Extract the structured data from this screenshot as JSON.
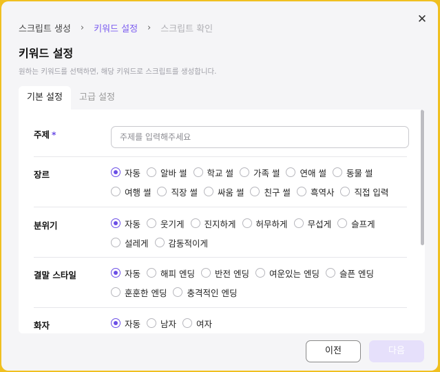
{
  "breadcrumb": {
    "step1": "스크립트 생성",
    "step2": "키워드 설정",
    "step3": "스크립트 확인",
    "separator": "›"
  },
  "dialog": {
    "close_glyph": "✕",
    "title": "키워드 설정",
    "subtitle": "원하는 키워드를 선택하면, 해당 키워드로 스크립트를 생성합니다."
  },
  "tabs": {
    "basic": "기본 설정",
    "advanced": "고급 설정"
  },
  "topic": {
    "label": "주제",
    "required_mark": "*",
    "placeholder": "주제를 입력해주세요",
    "value": ""
  },
  "genre": {
    "label": "장르",
    "selected": "자동",
    "options": [
      "자동",
      "알바 썰",
      "학교 썰",
      "가족 썰",
      "연애 썰",
      "동물 썰",
      "여행 썰",
      "직장 썰",
      "싸움 썰",
      "친구 썰",
      "흑역사",
      "직접 입력"
    ]
  },
  "mood": {
    "label": "분위기",
    "selected": "자동",
    "options": [
      "자동",
      "웃기게",
      "진지하게",
      "허무하게",
      "무섭게",
      "슬프게",
      "설레게",
      "감동적이게"
    ]
  },
  "ending": {
    "label": "결말 스타일",
    "selected": "자동",
    "options": [
      "자동",
      "해피 엔딩",
      "반전 엔딩",
      "여운있는 엔딩",
      "슬픈 엔딩",
      "훈훈한 엔딩",
      "충격적인 엔딩"
    ]
  },
  "narrator": {
    "label": "화자",
    "selected": "자동",
    "options": [
      "자동",
      "남자",
      "여자"
    ]
  },
  "footer": {
    "prev_label": "이전",
    "next_label": "다음"
  }
}
